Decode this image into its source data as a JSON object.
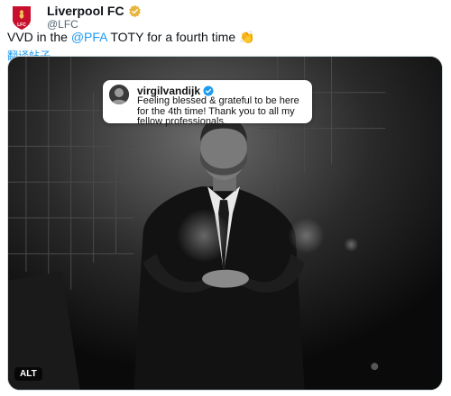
{
  "account": {
    "name": "Liverpool FC",
    "handle": "@LFC",
    "crest_letters": "LFC"
  },
  "tweet": {
    "text_before": "VVD in the ",
    "mention": "@PFA",
    "text_after": " TOTY for a fourth time ",
    "emoji": "👏"
  },
  "translate_label": "翻译帖子",
  "embedded_card": {
    "username": "virgilvandijk",
    "text": "Feeling blessed & grateful to be here for the 4th time! Thank you to all my fellow professionals."
  },
  "alt_badge": "ALT",
  "colors": {
    "accent": "#1d9bf0",
    "crest_red": "#c8102e",
    "verified_gold": "#e8b339"
  }
}
